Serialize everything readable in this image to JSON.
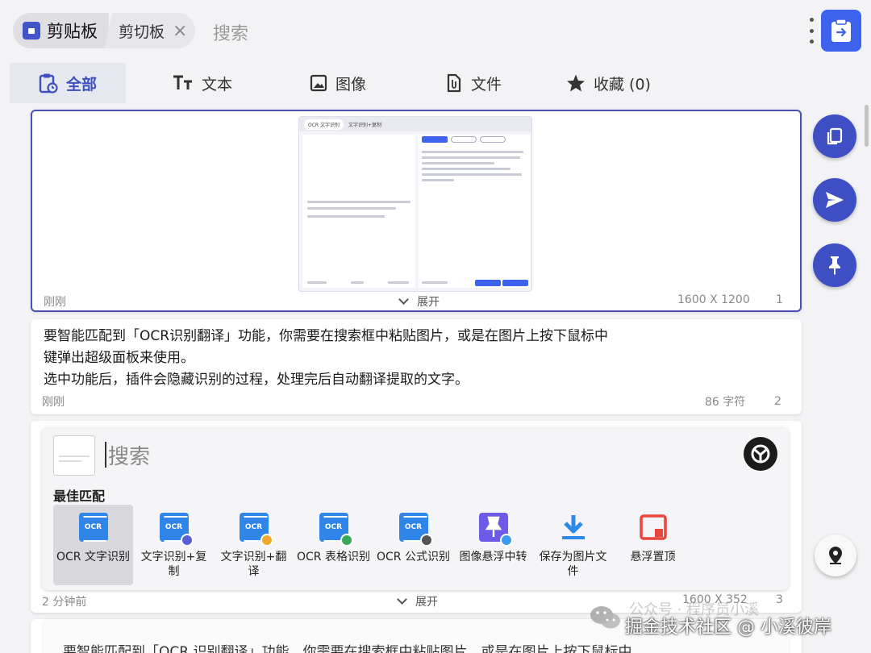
{
  "topbar": {
    "active_chip": "剪贴板",
    "second_chip": "剪切板",
    "close_symbol": "×",
    "search_placeholder": "搜索"
  },
  "tabs": [
    {
      "label": "全部",
      "icon": "clipboard-clock-icon"
    },
    {
      "label": "文本",
      "icon": "text-icon"
    },
    {
      "label": "图像",
      "icon": "image-icon"
    },
    {
      "label": "文件",
      "icon": "file-icon"
    },
    {
      "label": "收藏 (0)",
      "icon": "star-icon"
    }
  ],
  "items": [
    {
      "time": "刚刚",
      "expand": "展开",
      "size": "1600 X 1200",
      "index": "1",
      "thumb": {
        "tab1": "OCR 文字识别",
        "tab2": "文字识别+复制"
      }
    },
    {
      "lines": [
        "要智能匹配到「OCR识别翻译」功能，你需要在搜索框中粘贴图片，或是在图片上按下鼠标中",
        "键弹出超级面板来使用。",
        "选中功能后，插件会隐藏识别的过程，处理完后自动翻译提取的文字。"
      ],
      "time": "刚刚",
      "chars": "86 字符",
      "index": "2"
    },
    {
      "panel_search": "搜索",
      "best_match": "最佳匹配",
      "actions": [
        {
          "label": "OCR 文字识别",
          "icon": "ocr-icon"
        },
        {
          "label": "文字识别+复制",
          "icon": "ocr-copy-icon"
        },
        {
          "label": "文字识别+翻译",
          "icon": "ocr-translate-icon"
        },
        {
          "label": "OCR 表格识别",
          "icon": "ocr-table-icon"
        },
        {
          "label": "OCR 公式识别",
          "icon": "ocr-formula-icon"
        },
        {
          "label": "图像悬浮中转",
          "icon": "pin-image-icon"
        },
        {
          "label": "保存为图片文件",
          "icon": "download-icon"
        },
        {
          "label": "悬浮置顶",
          "icon": "float-top-icon"
        }
      ],
      "ocr_tag": "OCR",
      "time": "2 分钟前",
      "expand": "展开",
      "size": "1600 X 352",
      "index": "3"
    },
    {
      "text": "要智能匹配到「OCR 识别翻译」功能，你需要在搜索框中粘贴图片，或是在图片上按下鼠标中"
    }
  ],
  "watermark": "掘金技术社区 @ 小溪彼岸",
  "watermark_ghost": "公众号 · 程序员小溪",
  "colors": {
    "accent": "#3e4fc4",
    "paste_button": "#3d63ec",
    "selected_border": "#4a4fb8"
  }
}
